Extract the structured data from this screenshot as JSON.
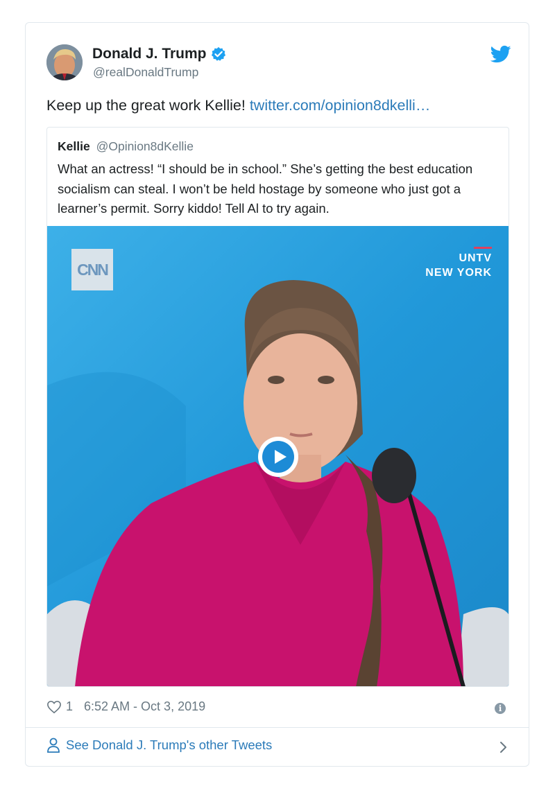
{
  "author": {
    "name": "Donald J. Trump",
    "handle": "@realDonaldTrump",
    "verified": true
  },
  "tweet": {
    "text": "Keep up the great work Kellie! ",
    "link_text": "twitter.com/opinion8dkelli…"
  },
  "quoted_tweet": {
    "name": "Kellie",
    "handle": "@Opinion8dKellie",
    "text": "What an actress! “I should be in school.” She’s getting the best education socialism can steal. I won’t be held hostage by someone who just got a learner’s permit. Sorry kiddo! Tell Al to try again.",
    "video": {
      "logo_text": "CNN",
      "overlay_line1": "UNTV",
      "overlay_line2": "NEW YORK"
    }
  },
  "footer": {
    "like_count": "1",
    "timestamp": "6:52 AM - Oct 3, 2019",
    "see_more": "See Donald J. Trump's other Tweets"
  },
  "colors": {
    "link": "#2b7bb9",
    "text": "#1c2022",
    "secondary": "#697882",
    "twitter_blue": "#1da1f2",
    "shirt": "#c8126d"
  },
  "icons": [
    "verified-badge-icon",
    "twitter-bird-icon",
    "play-icon",
    "heart-icon",
    "info-icon",
    "person-icon",
    "chevron-right-icon"
  ]
}
